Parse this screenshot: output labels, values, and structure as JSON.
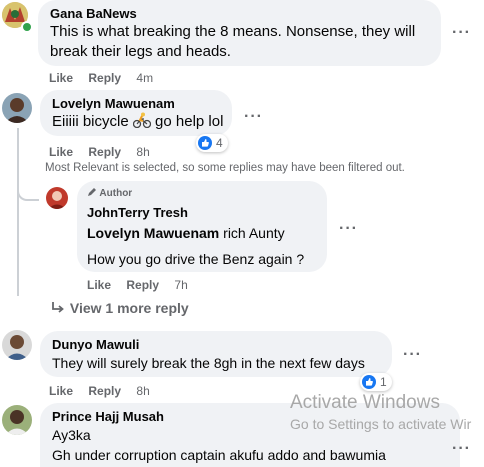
{
  "comments": {
    "c1": {
      "name": "Gana BaNews",
      "text_line1": "This is what breaking the 8 means. Nonsense, they will",
      "text_line2": "break their legs and heads.",
      "like": "Like",
      "reply": "Reply",
      "time": "4m"
    },
    "c2": {
      "name": "Lovelyn Mawuenam",
      "text_before": "Eiiiii bicycle ",
      "text_after": " go help lol",
      "emoji": "bicyclist-emoji",
      "like": "Like",
      "reply": "Reply",
      "time": "8h",
      "reaction_count": "4"
    },
    "filter_note": "Most Relevant is selected, so some replies may have been filtered out.",
    "reply1": {
      "author_badge": "Author",
      "name": "JohnTerry Tresh",
      "mention": "Lovelyn Mawuenam",
      "text_line1": " rich Aunty",
      "text_line2": "How you go drive the Benz again ?",
      "like": "Like",
      "reply": "Reply",
      "time": "7h"
    },
    "view_more": "View 1 more reply",
    "c3": {
      "name": "Dunyo Mawuli",
      "text": "They will surely break the 8gh in the next few days",
      "like": "Like",
      "reply": "Reply",
      "time": "8h",
      "reaction_count": "1"
    },
    "c4": {
      "name": "Prince Hajj Musah",
      "text_line1": "Ay3ka",
      "text_line2": "Gh under corruption captain akufu addo and bawumia"
    }
  },
  "watermark": {
    "line1": "Activate Windows",
    "line2": "Go to Settings to activate Wir"
  },
  "colors": {
    "bubble": "#f0f2f5",
    "secondary_text": "#65676b",
    "like_blue": "#1877f2",
    "online_green": "#31a24c"
  }
}
